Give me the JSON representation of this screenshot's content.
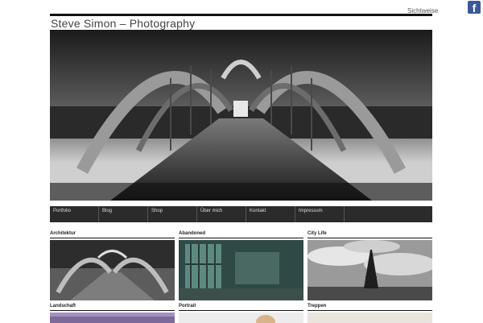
{
  "header": {
    "top_link": "Sichtweise",
    "facebook_icon": "facebook-icon",
    "site_title": "Steve Simon – Photography"
  },
  "nav": {
    "items": [
      "Portfolio",
      "Blog",
      "Shop",
      "Über mich",
      "Kontakt",
      "Impressum"
    ]
  },
  "categories": [
    {
      "label": "Architektur"
    },
    {
      "label": "Abandoned"
    },
    {
      "label": "City Life"
    },
    {
      "label": "Landschaft"
    },
    {
      "label": "Portrait"
    },
    {
      "label": "Treppen"
    }
  ],
  "colors": {
    "facebook": "#3b5998",
    "nav_background": "#2b2b2b"
  }
}
